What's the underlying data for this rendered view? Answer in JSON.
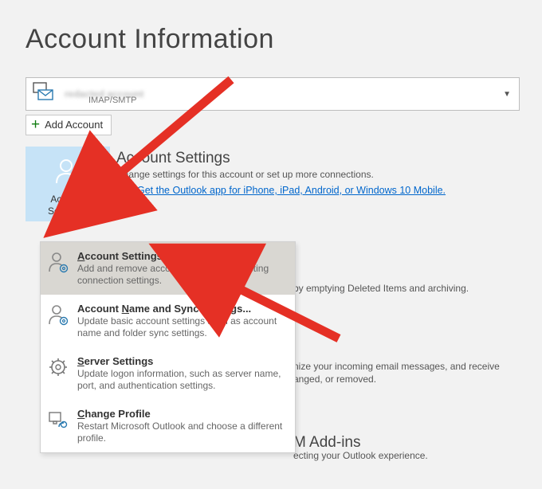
{
  "page": {
    "title": "Account Information"
  },
  "account_selector": {
    "name_redacted": "redacted account",
    "protocol": "IMAP/SMTP"
  },
  "add_account": {
    "label": "Add Account"
  },
  "account_settings_button": {
    "label_line1": "Account",
    "label_line2": "Settings"
  },
  "sections": {
    "account_settings": {
      "heading": "Account Settings",
      "sub": "Change settings for this account or set up more connections.",
      "link": "Get the Outlook app for iPhone, iPad, Android, or Windows 10 Mobile."
    },
    "mailbox_settings": {
      "partial_text": "by emptying Deleted Items and archiving."
    },
    "rules": {
      "partial_line1": "nize your incoming email messages, and receive",
      "partial_line2": "anged, or removed."
    },
    "addins": {
      "heading_partial": "M Add-ins",
      "partial": "ecting your Outlook experience."
    }
  },
  "dropdown": {
    "items": [
      {
        "title": "Account Settings...",
        "desc": "Add and remove accounts or change existing connection settings."
      },
      {
        "title": "Account Name and Sync Settings...",
        "desc": "Update basic account settings such as account name and folder sync settings."
      },
      {
        "title": "Server Settings",
        "desc": "Update logon information, such as server name, port, and authentication settings."
      },
      {
        "title": "Change Profile",
        "desc": "Restart Microsoft Outlook and choose a different profile."
      }
    ]
  }
}
